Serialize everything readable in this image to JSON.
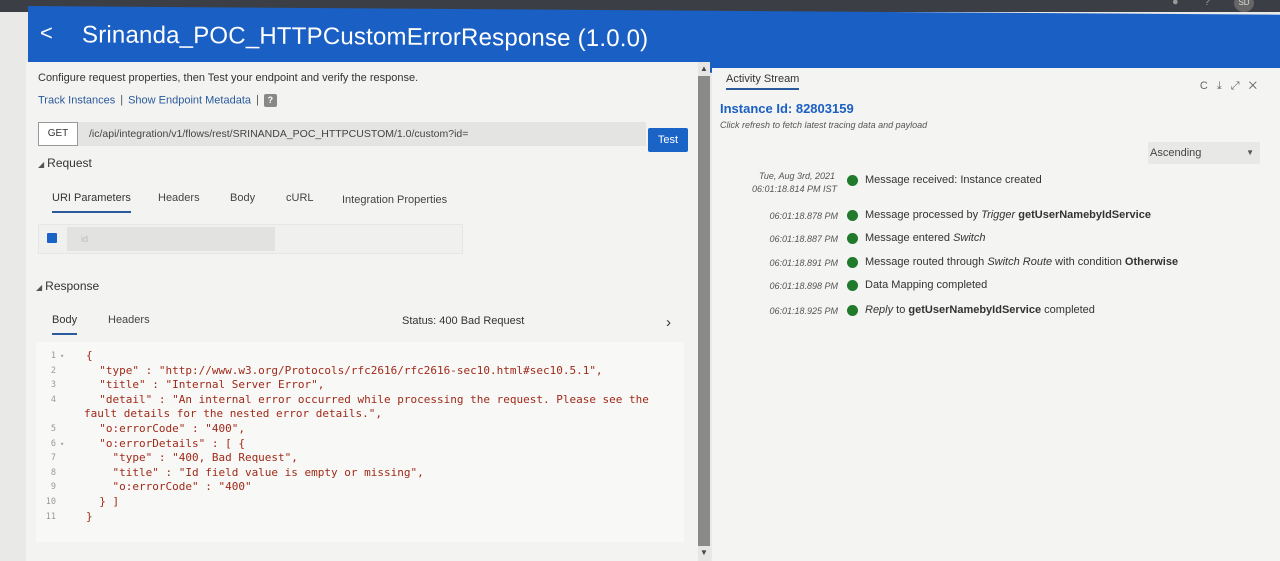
{
  "window": {
    "avatar_initials": "SD"
  },
  "header": {
    "back_glyph": "<",
    "title": "Srinanda_POC_HTTPCustomErrorResponse (1.0.0)"
  },
  "left": {
    "intro": "Configure request properties, then Test your endpoint and verify the response.",
    "links": {
      "track": "Track Instances",
      "metadata": "Show Endpoint Metadata",
      "help": "?"
    },
    "request": {
      "method": "GET",
      "url": "/ic/api/integration/v1/flows/rest/SRINANDA_POC_HTTPCUSTOM/1.0/custom?id=",
      "test_label": "Test"
    },
    "request_section": "Request",
    "request_tabs": [
      "URI Parameters",
      "Headers",
      "Body",
      "cURL",
      "Integration Properties"
    ],
    "param_name": "id",
    "response_section": "Response",
    "response_tabs": [
      "Body",
      "Headers"
    ],
    "status": "Status: 400 Bad Request",
    "code": {
      "line_numbers": [
        "1",
        "2",
        "3",
        "4",
        "",
        "5",
        "6",
        "7",
        "8",
        "9",
        "10",
        "11"
      ],
      "lines": [
        "{",
        "  \"type\" : \"http://www.w3.org/Protocols/rfc2616/rfc2616-sec10.html#sec10.5.1\",",
        "  \"title\" : \"Internal Server Error\",",
        "  \"detail\" : \"An internal error occurred while processing the request. Please see the",
        "fault details for the nested error details.\",",
        "  \"o:errorCode\" : \"400\",",
        "  \"o:errorDetails\" : [ {",
        "    \"type\" : \"400, Bad Request\",",
        "    \"title\" : \"Id field value is empty or missing\",",
        "    \"o:errorCode\" : \"400\"",
        "  } ]",
        "}"
      ]
    }
  },
  "right": {
    "tab": "Activity Stream",
    "tools": "C ⤓ ⤢ ✕",
    "instance": "Instance Id: 82803159",
    "hint": "Click refresh to fetch latest tracing data and payload",
    "sort_value": "Ascending",
    "first_date": "Tue, Aug 3rd, 2021",
    "first_time": "06:01:18.814 PM IST",
    "events": [
      {
        "time": "",
        "msg": "Message received: Instance created"
      },
      {
        "time": "06:01:18.878 PM",
        "pre": "Message processed by ",
        "em": "Trigger",
        "mid": " ",
        "bold": "getUserNamebyIdService",
        "post": ""
      },
      {
        "time": "06:01:18.887 PM",
        "pre": "Message entered ",
        "em": "Switch",
        "mid": "",
        "bold": "",
        "post": ""
      },
      {
        "time": "06:01:18.891 PM",
        "pre": "Message routed through ",
        "em": "Switch Route",
        "mid": " with condition ",
        "bold": "Otherwise",
        "post": ""
      },
      {
        "time": "06:01:18.898 PM",
        "msg": "Data Mapping completed"
      },
      {
        "time": "06:01:18.925 PM",
        "pre": "",
        "em": "Reply",
        "mid": " to ",
        "bold": "getUserNamebyIdService",
        "post": " completed"
      }
    ],
    "dot_color": "#1f7a2c"
  }
}
